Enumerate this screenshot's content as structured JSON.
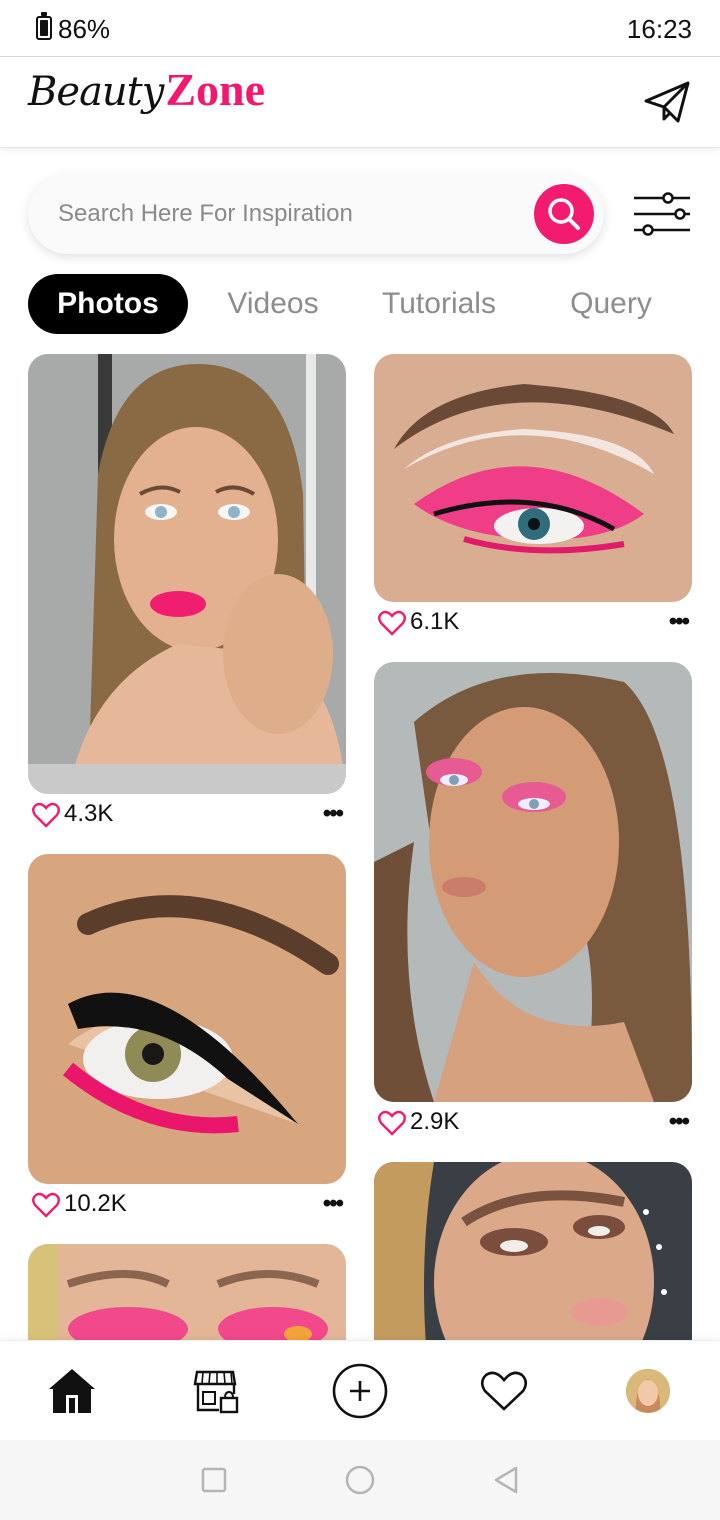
{
  "status_bar": {
    "battery": "86%",
    "battery_level": 0.86,
    "time": "16:23"
  },
  "header": {
    "logo_script": "Beauty",
    "logo_bold": "Zone",
    "brand_color": "#f5176f",
    "send_icon": "paper-plane-icon"
  },
  "search": {
    "placeholder": "Search Here For Inspiration",
    "value": "",
    "button_icon": "search-icon",
    "filter_icon": "sliders-icon"
  },
  "tabs": [
    {
      "label": "Photos",
      "active": true
    },
    {
      "label": "Videos",
      "active": false
    },
    {
      "label": "Tutorials",
      "active": false
    },
    {
      "label": "Query",
      "active": false
    }
  ],
  "feed": {
    "left": [
      {
        "likes": "4.3K",
        "image": "woman with pink lipstick"
      },
      {
        "likes": "10.2K",
        "image": "eye with black winged liner and pink lashes"
      },
      {
        "likes": "",
        "image": "pink eyeshadow"
      }
    ],
    "right": [
      {
        "likes": "6.1K",
        "image": "pink cut-crease eyeshadow"
      },
      {
        "likes": "2.9K",
        "image": "woman with pink eyeshadow"
      },
      {
        "likes": "",
        "image": "glam makeup woman"
      }
    ],
    "more_label": "•••",
    "heart_color": "#f21b70"
  },
  "bottom_nav": [
    {
      "icon": "home-icon",
      "active": true
    },
    {
      "icon": "shop-icon",
      "active": false
    },
    {
      "icon": "add-icon",
      "active": false
    },
    {
      "icon": "heart-icon",
      "active": false
    },
    {
      "icon": "profile-avatar",
      "active": false
    }
  ],
  "system_nav": [
    "recents-icon",
    "home-circle-icon",
    "back-icon"
  ]
}
